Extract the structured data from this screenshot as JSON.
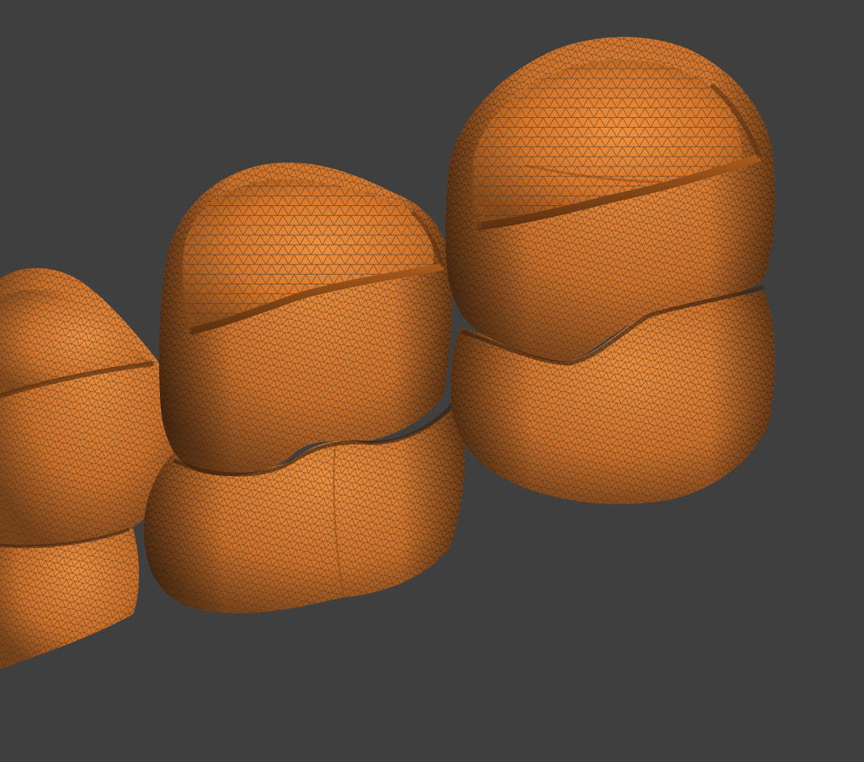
{
  "viewport": {
    "background_color": "#3f3f3f"
  },
  "model": {
    "kind": "dental crown triangle mesh",
    "material_color": "#d9772a",
    "wireframe_color": "#3a3a3a",
    "objects": [
      {
        "name": "crown-left-partial"
      },
      {
        "name": "crown-middle"
      },
      {
        "name": "crown-right"
      }
    ]
  }
}
